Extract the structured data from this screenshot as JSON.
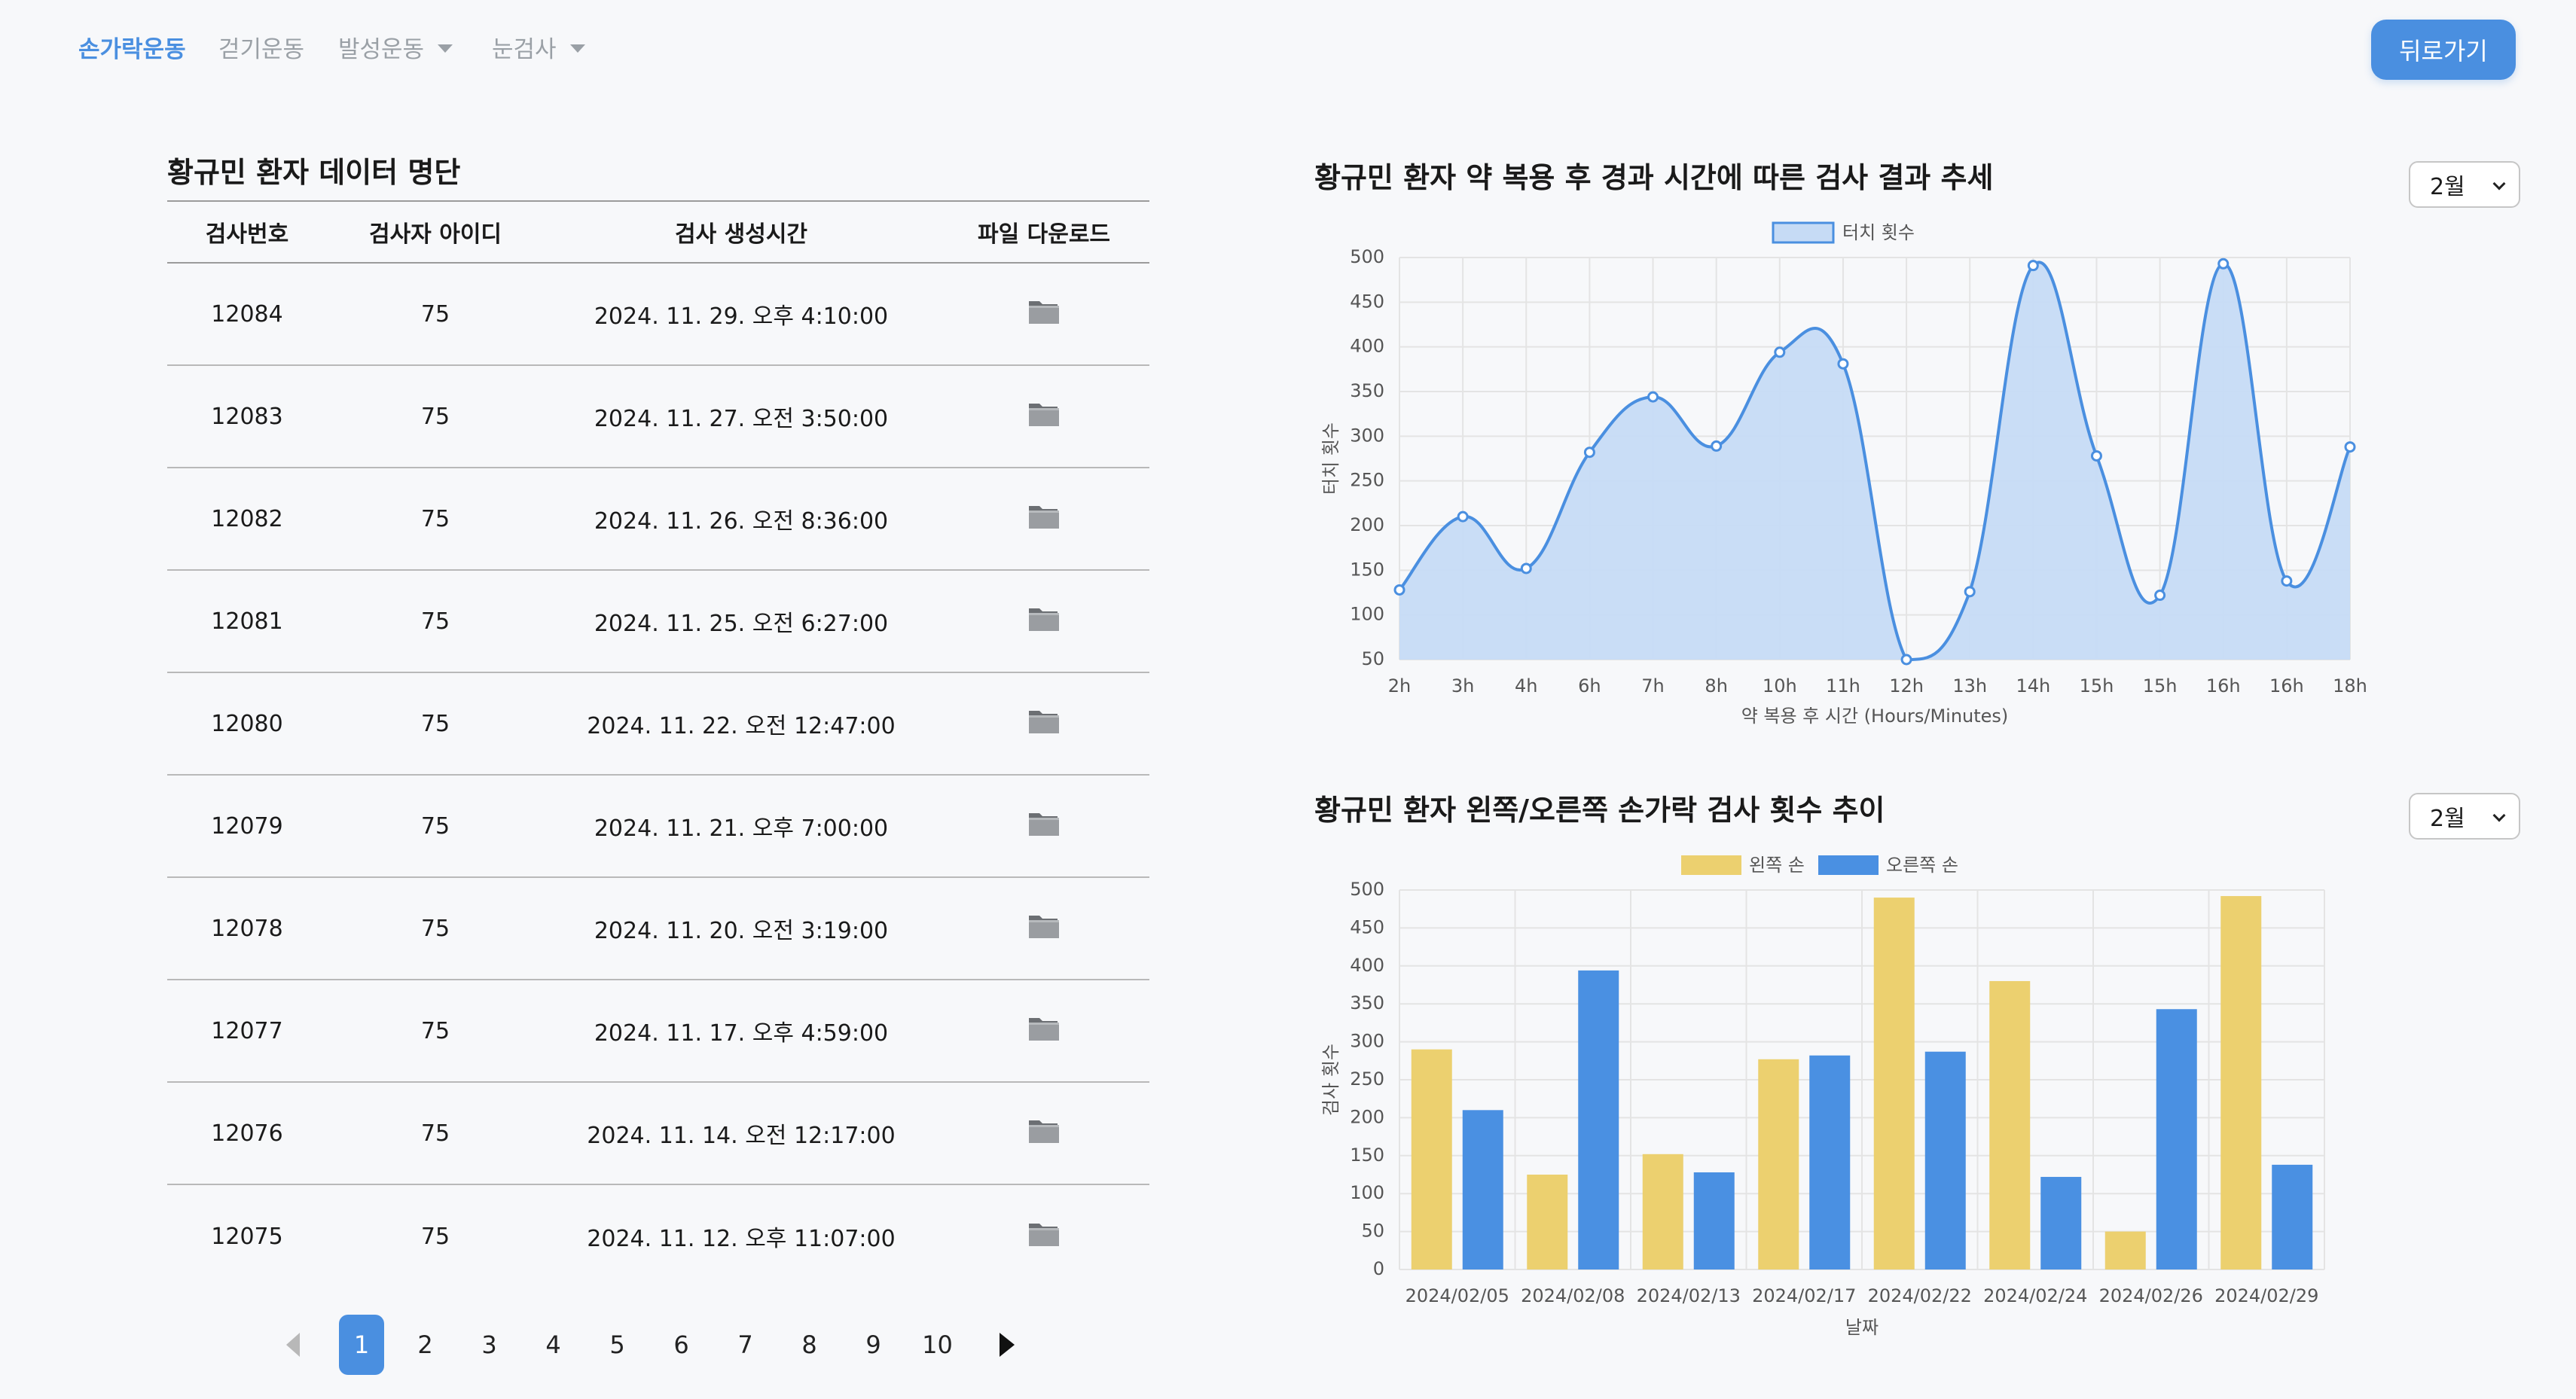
{
  "nav": {
    "items": [
      {
        "label": "손가락운동",
        "active": true,
        "dropdown": false
      },
      {
        "label": "걷기운동",
        "active": false,
        "dropdown": false
      },
      {
        "label": "발성운동",
        "active": false,
        "dropdown": true
      },
      {
        "label": "눈검사",
        "active": false,
        "dropdown": true
      }
    ],
    "back_label": "뒤로가기"
  },
  "table": {
    "title": "황규민 환자 데이터 명단",
    "headers": [
      "검사번호",
      "검사자 아이디",
      "검사 생성시간",
      "파일 다운로드"
    ],
    "rows": [
      {
        "id": "12084",
        "user": "75",
        "time": "2024. 11. 29. 오후 4:10:00"
      },
      {
        "id": "12083",
        "user": "75",
        "time": "2024. 11. 27. 오전 3:50:00"
      },
      {
        "id": "12082",
        "user": "75",
        "time": "2024. 11. 26. 오전 8:36:00"
      },
      {
        "id": "12081",
        "user": "75",
        "time": "2024. 11. 25. 오전 6:27:00"
      },
      {
        "id": "12080",
        "user": "75",
        "time": "2024. 11. 22. 오전 12:47:00"
      },
      {
        "id": "12079",
        "user": "75",
        "time": "2024. 11. 21. 오후 7:00:00"
      },
      {
        "id": "12078",
        "user": "75",
        "time": "2024. 11. 20. 오전 3:19:00"
      },
      {
        "id": "12077",
        "user": "75",
        "time": "2024. 11. 17. 오후 4:59:00"
      },
      {
        "id": "12076",
        "user": "75",
        "time": "2024. 11. 14. 오전 12:17:00"
      },
      {
        "id": "12075",
        "user": "75",
        "time": "2024. 11. 12. 오후 11:07:00"
      }
    ]
  },
  "pagination": {
    "pages": [
      "1",
      "2",
      "3",
      "4",
      "5",
      "6",
      "7",
      "8",
      "9",
      "10"
    ],
    "current": "1"
  },
  "chart1_ui": {
    "title": "황규민 환자 약 복용 후 경과 시간에 따른 검사 결과 추세",
    "month": "2월"
  },
  "chart2_ui": {
    "title": "황규민 환자 왼쪽/오른쪽 손가락 검사 횟수 추이",
    "month": "2월"
  },
  "colors": {
    "accent": "#4a8fe0",
    "line": "#4a8fe0",
    "area": "#c6dbf5",
    "left_hand": "#ecd06f",
    "right_hand": "#4a90e2"
  },
  "chart_data": [
    {
      "type": "line",
      "title": "",
      "legend": [
        "터치 횟수"
      ],
      "xlabel": "약 복용 후 시간 (Hours/Minutes)",
      "ylabel": "터치 횟수",
      "ylim": [
        50,
        500
      ],
      "yticks": [
        50,
        100,
        150,
        200,
        250,
        300,
        350,
        400,
        450,
        500
      ],
      "categories": [
        "2h",
        "3h",
        "4h",
        "6h",
        "7h",
        "8h",
        "10h",
        "11h",
        "12h",
        "13h",
        "14h",
        "15h",
        "15h",
        "16h",
        "16h",
        "18h"
      ],
      "series": [
        {
          "name": "터치 횟수",
          "values": [
            128,
            210,
            152,
            282,
            344,
            289,
            394,
            381,
            50,
            126,
            491,
            278,
            122,
            493,
            138,
            288
          ]
        }
      ],
      "grid": true,
      "legend_position": "top"
    },
    {
      "type": "bar",
      "title": "",
      "xlabel": "날짜",
      "ylabel": "검사 횟수",
      "ylim": [
        0,
        500
      ],
      "yticks": [
        0,
        50,
        100,
        150,
        200,
        250,
        300,
        350,
        400,
        450,
        500
      ],
      "categories": [
        "2024/02/05",
        "2024/02/08",
        "2024/02/13",
        "2024/02/17",
        "2024/02/22",
        "2024/02/24",
        "2024/02/26",
        "2024/02/29"
      ],
      "series": [
        {
          "name": "왼쪽 손",
          "values": [
            290,
            125,
            152,
            277,
            490,
            380,
            50,
            492
          ]
        },
        {
          "name": "오른쪽 손",
          "values": [
            210,
            394,
            128,
            282,
            287,
            122,
            343,
            138
          ]
        }
      ],
      "grid": true,
      "legend_position": "top"
    }
  ]
}
